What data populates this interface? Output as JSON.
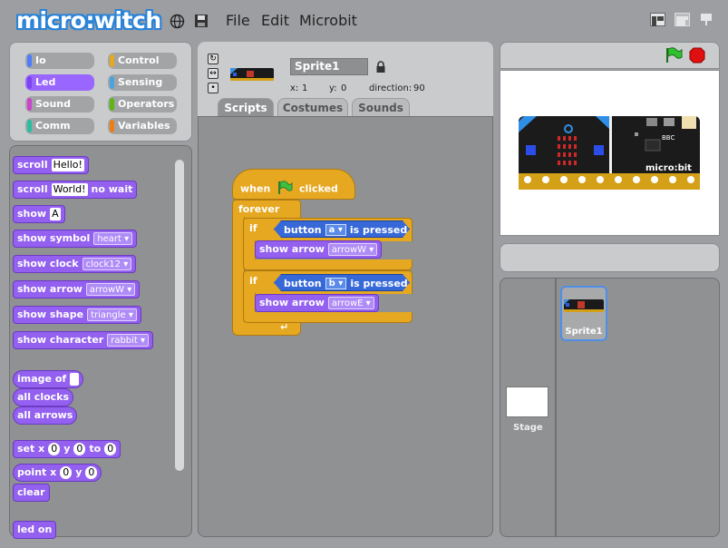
{
  "app": {
    "logo_text": "micro:witch"
  },
  "menu": {
    "file": "File",
    "edit": "Edit",
    "microbit": "Microbit"
  },
  "categories": [
    {
      "label": "Io",
      "color": "#4d7cff"
    },
    {
      "label": "Control",
      "color": "#e6a821"
    },
    {
      "label": "Led",
      "color": "#9966ff"
    },
    {
      "label": "Sensing",
      "color": "#4aa3df"
    },
    {
      "label": "Sound",
      "color": "#cc44cc"
    },
    {
      "label": "Operators",
      "color": "#5cb712"
    },
    {
      "label": "Comm",
      "color": "#26c0a0"
    },
    {
      "label": "Variables",
      "color": "#ee7d16"
    }
  ],
  "palette": {
    "scroll": {
      "label": "scroll",
      "arg": "Hello!"
    },
    "scroll_nowait": {
      "label": "scroll",
      "arg": "World!",
      "suffix": "no wait"
    },
    "show": {
      "label": "show",
      "arg": "A"
    },
    "show_symbol": {
      "label": "show symbol",
      "arg": "heart"
    },
    "show_clock": {
      "label": "show clock",
      "arg": "clock12"
    },
    "show_arrow": {
      "label": "show arrow",
      "arg": "arrowW"
    },
    "show_shape": {
      "label": "show shape",
      "arg": "triangle"
    },
    "show_character": {
      "label": "show character",
      "arg": "rabbit"
    },
    "image_of": {
      "label": "image of"
    },
    "all_clocks": {
      "label": "all clocks"
    },
    "all_arrows": {
      "label": "all arrows"
    },
    "set": {
      "label": "set x",
      "x": "0",
      "y_label": "y",
      "y": "0",
      "to_label": "to",
      "to": "0"
    },
    "point": {
      "label": "point x",
      "x": "0",
      "y_label": "y",
      "y": "0"
    },
    "clear": {
      "label": "clear"
    },
    "led_on": {
      "label": "led on"
    }
  },
  "sprite": {
    "name": "Sprite1",
    "x_label": "x:",
    "x": "1",
    "y_label": "y:",
    "y": "0",
    "direction_label": "direction:",
    "direction": "90"
  },
  "tabs": {
    "scripts": "Scripts",
    "costumes": "Costumes",
    "sounds": "Sounds"
  },
  "script": {
    "when": "when",
    "clicked": "clicked",
    "forever": "forever",
    "if1": {
      "if": "if",
      "button": "button",
      "key": "a",
      "is_pressed": "is pressed",
      "action": "show arrow",
      "arg": "arrowW"
    },
    "if2": {
      "if": "if",
      "button": "button",
      "key": "b",
      "is_pressed": "is pressed",
      "action": "show arrow",
      "arg": "arrowE"
    }
  },
  "stage_panel": {
    "stage_label": "Stage",
    "sprite_label": "Sprite1",
    "board_text": "micro:bit",
    "board_brand": "BBC"
  }
}
